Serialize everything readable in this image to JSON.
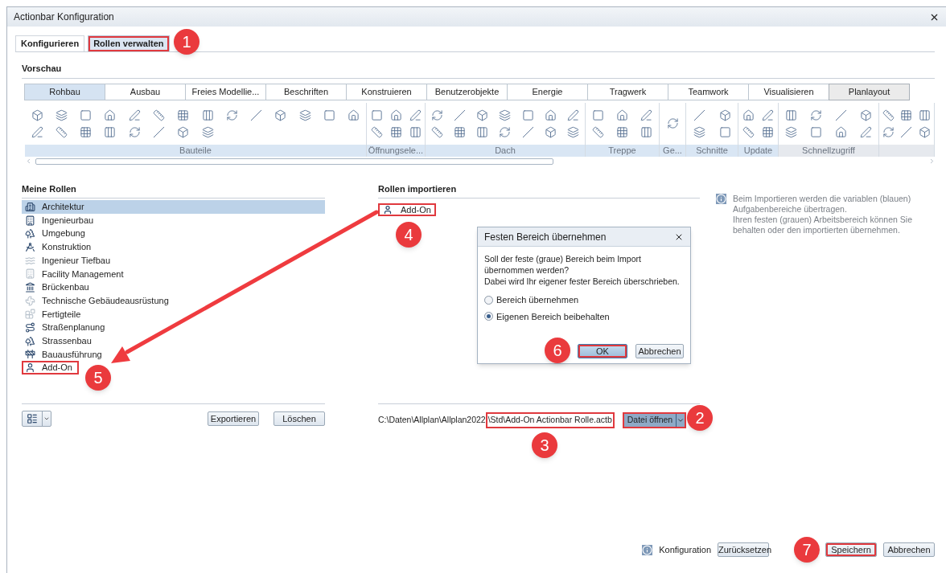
{
  "window": {
    "title": "Actionbar Konfiguration"
  },
  "tabs": [
    {
      "label": "Konfigurieren",
      "selected": false,
      "highlighted": false
    },
    {
      "label": "Rollen verwalten",
      "selected": true,
      "highlighted": true
    }
  ],
  "preview": {
    "title": "Vorschau",
    "tabs": [
      {
        "label": "Rohbau",
        "selected": true,
        "fixed": false
      },
      {
        "label": "Ausbau",
        "selected": false,
        "fixed": false
      },
      {
        "label": "Freies Modellie...",
        "selected": false,
        "fixed": false
      },
      {
        "label": "Beschriften",
        "selected": false,
        "fixed": false
      },
      {
        "label": "Konstruieren",
        "selected": false,
        "fixed": false
      },
      {
        "label": "Benutzerobjekte",
        "selected": false,
        "fixed": false
      },
      {
        "label": "Energie",
        "selected": false,
        "fixed": false
      },
      {
        "label": "Tragwerk",
        "selected": false,
        "fixed": false
      },
      {
        "label": "Teamwork",
        "selected": false,
        "fixed": false
      },
      {
        "label": "Visualisieren",
        "selected": false,
        "fixed": false
      },
      {
        "label": "Planlayout",
        "selected": false,
        "fixed": true
      }
    ],
    "groups": [
      {
        "label": "Bauteile",
        "fixed": false
      },
      {
        "label": "Öffnungsele...",
        "fixed": false
      },
      {
        "label": "Dach",
        "fixed": false
      },
      {
        "label": "Treppe",
        "fixed": false
      },
      {
        "label": "Ge...",
        "fixed": false
      },
      {
        "label": "Schnitte",
        "fixed": false
      },
      {
        "label": "Update",
        "fixed": false
      },
      {
        "label": "Schnellzugriff",
        "fixed": true
      },
      {
        "fixed": true
      }
    ]
  },
  "my_roles": {
    "title": "Meine Rollen",
    "items": [
      {
        "label": "Architektur",
        "selected": true,
        "dimmed": false,
        "highlighted": false
      },
      {
        "label": "Ingenieurbau",
        "selected": false,
        "dimmed": false,
        "highlighted": false
      },
      {
        "label": "Umgebung",
        "selected": false,
        "dimmed": false,
        "highlighted": false
      },
      {
        "label": "Konstruktion",
        "selected": false,
        "dimmed": false,
        "highlighted": false
      },
      {
        "label": "Ingenieur Tiefbau",
        "selected": false,
        "dimmed": true,
        "highlighted": false
      },
      {
        "label": "Facility Management",
        "selected": false,
        "dimmed": true,
        "highlighted": false
      },
      {
        "label": "Brückenbau",
        "selected": false,
        "dimmed": false,
        "highlighted": false
      },
      {
        "label": "Technische Gebäudeausrüstung",
        "selected": false,
        "dimmed": true,
        "highlighted": false
      },
      {
        "label": "Fertigteile",
        "selected": false,
        "dimmed": true,
        "highlighted": false
      },
      {
        "label": "Straßenplanung",
        "selected": false,
        "dimmed": false,
        "highlighted": false
      },
      {
        "label": "Strassenbau",
        "selected": false,
        "dimmed": false,
        "highlighted": false
      },
      {
        "label": "Bauausführung",
        "selected": false,
        "dimmed": false,
        "highlighted": false
      },
      {
        "label": "Add-On",
        "selected": false,
        "dimmed": false,
        "highlighted": true
      }
    ],
    "buttons": [
      "Exportieren",
      "Löschen"
    ]
  },
  "import_roles": {
    "title": "Rollen importieren",
    "items": [
      {
        "label": "Add-On",
        "highlighted": true
      }
    ],
    "path_start": "C:\\Daten\\Allplan\\Allplan2022",
    "path_end": "\\Std\\Add-On Actionbar Rolle.actb",
    "open_button": {
      "label": "Datei öffnen",
      "highlighted": true
    }
  },
  "info": [
    "Beim Importieren werden die variablen (blauen) Aufgabenbereiche übertragen.",
    "Ihren festen (grauen) Arbeitsbereich können Sie behalten oder den importierten übernehmen."
  ],
  "dialog": {
    "title": "Festen Bereich übernehmen",
    "message": [
      "Soll der feste (graue) Bereich beim Import übernommen werden?",
      "Dabei wird Ihr eigener fester Bereich überschrieben."
    ],
    "options": [
      {
        "label": "Bereich übernehmen",
        "selected": false
      },
      {
        "label": "Eigenen Bereich beibehalten",
        "selected": true
      }
    ],
    "buttons": [
      {
        "label": "OK",
        "default": true,
        "highlighted": true
      },
      {
        "label": "Abbrechen",
        "default": false,
        "highlighted": false
      }
    ]
  },
  "footer": {
    "info_label": "Konfiguration",
    "buttons": [
      {
        "label": "Zurücksetzen",
        "highlighted": false
      },
      {
        "label": "Speichern",
        "highlighted": true
      },
      {
        "label": "Abbrechen",
        "highlighted": false
      }
    ]
  },
  "annotations": [
    "1",
    "2",
    "3",
    "4",
    "5",
    "6",
    "7"
  ]
}
